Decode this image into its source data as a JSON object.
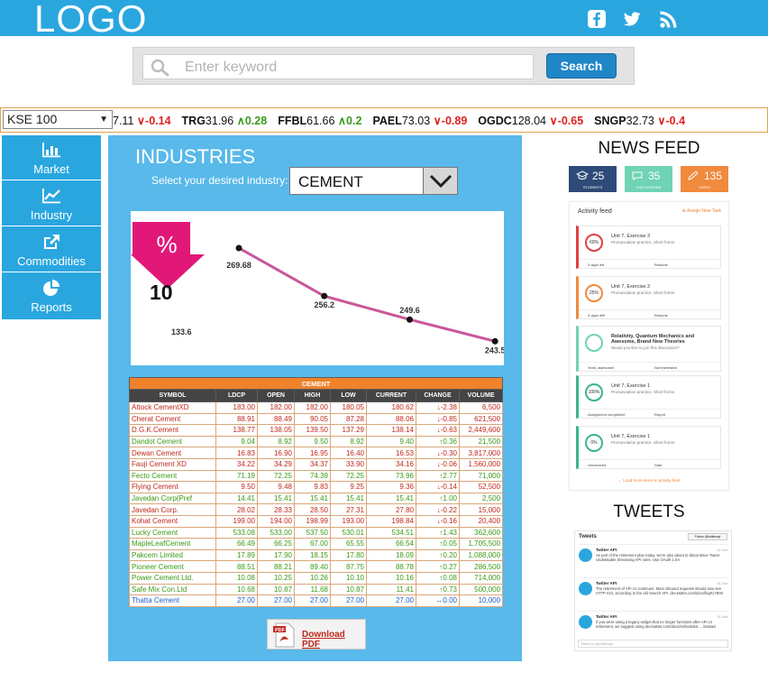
{
  "header": {
    "logo": "LOGO",
    "social": [
      "facebook-icon",
      "twitter-icon",
      "rss-icon"
    ]
  },
  "search": {
    "placeholder": "Enter keyword",
    "button": "Search"
  },
  "ticker": {
    "select": "KSE 100",
    "items": [
      {
        "symbol": "",
        "value": "7.11",
        "change": "-0.14",
        "dir": "down"
      },
      {
        "symbol": "TRG",
        "value": "31.96",
        "change": "0.28",
        "dir": "up"
      },
      {
        "symbol": "FFBL",
        "value": "61.66",
        "change": "0.2",
        "dir": "up"
      },
      {
        "symbol": "PAEL",
        "value": "73.03",
        "change": "-0.89",
        "dir": "down"
      },
      {
        "symbol": "OGDC",
        "value": "128.04",
        "change": "-0.65",
        "dir": "down"
      },
      {
        "symbol": "SNGP",
        "value": "32.73",
        "change": "-0.4",
        "dir": "down"
      }
    ]
  },
  "nav": [
    {
      "label": "Market",
      "icon": "bar-chart-icon"
    },
    {
      "label": "Industry",
      "icon": "line-chart-icon"
    },
    {
      "label": "Commodities",
      "icon": "external-link-icon"
    },
    {
      "label": "Reports",
      "icon": "pie-chart-icon"
    }
  ],
  "industries": {
    "title": "INDUSTRIES",
    "select_label": "Select your desired industry:",
    "selected": "CEMENT",
    "percent_symbol": "%",
    "percent_value": "10",
    "side_value": "133.6",
    "download": "Download PDF"
  },
  "chart_data": {
    "type": "line",
    "x": [
      1,
      2,
      3,
      4
    ],
    "values": [
      269.68,
      256.2,
      249.6,
      243.5
    ],
    "labels": [
      "269.68",
      "256.2",
      "249.6",
      "243.5"
    ],
    "ylim": [
      238,
      275
    ],
    "color": "#c9579a"
  },
  "table": {
    "caption": "CEMENT",
    "columns": [
      "SYMBOL",
      "LDCP",
      "OPEN",
      "HIGH",
      "LOW",
      "CURRENT",
      "CHANGE",
      "VOLUME"
    ],
    "rows": [
      {
        "c": [
          "Attock CementXD",
          "183.00",
          "182.00",
          "182.00",
          "180.05",
          "180.62",
          "↓-2.38",
          "6,500"
        ],
        "color": "red"
      },
      {
        "c": [
          "Cherat Cement",
          "88.91",
          "88.49",
          "90.05",
          "87.28",
          "88.06",
          "↓-0.85",
          "621,500"
        ],
        "color": "red"
      },
      {
        "c": [
          "D.G.K.Cement",
          "138.77",
          "138.05",
          "139.50",
          "137.29",
          "138.14",
          "↓-0.63",
          "2,449,600"
        ],
        "color": "red"
      },
      {
        "c": [
          "Dandot Cement",
          "9.04",
          "8.92",
          "9.50",
          "8.92",
          "9.40",
          "↑0.36",
          "21,500"
        ],
        "color": "green"
      },
      {
        "c": [
          "Dewan Cement",
          "16.83",
          "16.90",
          "16.95",
          "16.40",
          "16.53",
          "↓-0.30",
          "3,817,000"
        ],
        "color": "red"
      },
      {
        "c": [
          "Fauji Cement XD",
          "34.22",
          "34.29",
          "34.37",
          "33.90",
          "34.16",
          "↓-0.06",
          "1,560,000"
        ],
        "color": "red"
      },
      {
        "c": [
          "Fecto Cement",
          "71.19",
          "72.25",
          "74.39",
          "72.25",
          "73.96",
          "↑2.77",
          "71,000"
        ],
        "color": "green"
      },
      {
        "c": [
          "Flying Cement",
          "9.50",
          "9.48",
          "9.83",
          "9.25",
          "9.36",
          "↓-0.14",
          "52,500"
        ],
        "color": "red"
      },
      {
        "c": [
          "Javedan Corp(Pref",
          "14.41",
          "15.41",
          "15.41",
          "15.41",
          "15.41",
          "↑1.00",
          "2,500"
        ],
        "color": "green"
      },
      {
        "c": [
          "Javedan Corp.",
          "28.02",
          "28.33",
          "28.50",
          "27.31",
          "27.80",
          "↓-0.22",
          "15,000"
        ],
        "color": "red"
      },
      {
        "c": [
          "Kohat Cement",
          "199.00",
          "194.00",
          "198.99",
          "193.00",
          "198.84",
          "↓-0.16",
          "20,400"
        ],
        "color": "red"
      },
      {
        "c": [
          "Lucky Cement",
          "533.08",
          "533.00",
          "537.50",
          "530.01",
          "534.51",
          "↑1.43",
          "362,600"
        ],
        "color": "green"
      },
      {
        "c": [
          "MapleLeafCement",
          "66.49",
          "66.25",
          "67.00",
          "65.55",
          "66.54",
          "↑0.05",
          "1,705,500"
        ],
        "color": "green"
      },
      {
        "c": [
          "Pakcem Limited",
          "17.89",
          "17.90",
          "18.15",
          "17.80",
          "18.09",
          "↑0.20",
          "1,088,000"
        ],
        "color": "green"
      },
      {
        "c": [
          "Pioneer Cement",
          "88.51",
          "88.21",
          "89.40",
          "87.75",
          "88.78",
          "↑0.27",
          "286,500"
        ],
        "color": "green"
      },
      {
        "c": [
          "Power Cement Ltd.",
          "10.08",
          "10.25",
          "10.26",
          "10.10",
          "10.16",
          "↑0.08",
          "714,000"
        ],
        "color": "green"
      },
      {
        "c": [
          "Safe Mix Con.Ltd",
          "10.68",
          "10.87",
          "11.68",
          "10.87",
          "11.41",
          "↑0.73",
          "500,000"
        ],
        "color": "green"
      },
      {
        "c": [
          "Thatta Cement",
          "27.00",
          "27.00",
          "27.00",
          "27.00",
          "27.00",
          "↔0.00",
          "10,000"
        ],
        "color": "blue"
      }
    ]
  },
  "news": {
    "title": "NEWS FEED",
    "stats": [
      {
        "n": "25",
        "s": "STUDENTS",
        "color": "#2e4a78"
      },
      {
        "n": "35",
        "s": "DISCUSSIONS",
        "color": "#6fd3b4"
      },
      {
        "n": "135",
        "s": "TASKS",
        "color": "#f08a3c"
      }
    ],
    "feed_title": "Activity feed",
    "feed_link": "⊕ Assign New Task",
    "cards": [
      {
        "t1": "Unit 7, Exercise 3",
        "t2": "Pronunciation practice, Short forms",
        "ring": "60%",
        "a": "3 days left",
        "b": "Resume",
        "color": "#e04040"
      },
      {
        "t1": "Unit 7, Exercise 2",
        "t2": "Pronunciation practice, Short forms",
        "ring": "25%",
        "a": "3 days left!",
        "b": "Resume",
        "color": "#f08a3c"
      },
      {
        "t1": "Relativity, Quantum Mechanics and Awesome, Brand New Theories",
        "t2": "Would you like to join this discussion?",
        "ring": "",
        "a": "Yeah, awesome!",
        "b": "Not interested",
        "color": "#6fd3b4"
      },
      {
        "t1": "Unit 7, Exercise 1",
        "t2": "Pronunciation practice, Short forms",
        "ring": "100%",
        "a": "Assignment completed!",
        "b": "Report",
        "color": "#3bb58a"
      },
      {
        "t1": "Unit 7, Exercise 1",
        "t2": "Pronunciation practice, Short forms",
        "ring": "0%",
        "a": "Unresolved",
        "b": "Start",
        "color": "#3bb58a"
      }
    ],
    "more": "← Load more items in activity feed"
  },
  "tweets": {
    "title": "TWEETS",
    "head": "Tweets",
    "follow": "Follow @twitterapi",
    "items": [
      {
        "name": "Twitter API",
        "time": "11 Jun",
        "body": "As part of the retirement plan today, we're also about to discontinue Tweet Undeletable Streaming API rules. Use OAuth 1.0A."
      },
      {
        "name": "Twitter API",
        "time": "11 Jun",
        "body": "The retirement of API v1 continues. Most inbound requests should now see HTTP 410, according to the old Search API. dev.twitter.com/docs/faq#17800"
      },
      {
        "name": "Twitter API",
        "time": "11 Jun",
        "body": "If you were using a legacy widget that no longer functions after API v1 retirement, we suggest using dev.twitter.com/docs/embedded ... instead."
      }
    ],
    "input": "Tweet to @twitterapi"
  }
}
